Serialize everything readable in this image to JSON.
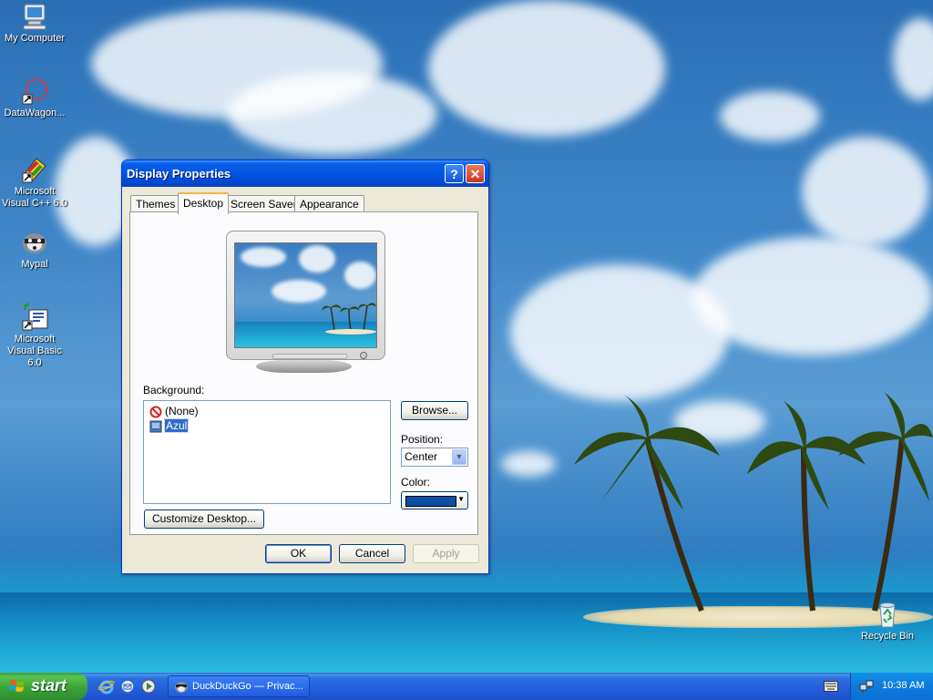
{
  "desktop": {
    "icons": [
      {
        "label": "My Computer",
        "icon": "computer-icon"
      },
      {
        "label": "DataWagon...",
        "icon": "datawagon-icon"
      },
      {
        "label": "Microsoft Visual C++ 6.0",
        "icon": "visual-cpp-icon"
      },
      {
        "label": "Mypal",
        "icon": "mypal-icon"
      },
      {
        "label": "Microsoft Visual Basic 6.0",
        "icon": "visual-basic-icon"
      },
      {
        "label": "Recycle Bin",
        "icon": "recycle-bin-icon"
      }
    ]
  },
  "window": {
    "title": "Display Properties",
    "help_glyph": "?",
    "close_glyph": "✕",
    "tabs": [
      {
        "label": "Themes"
      },
      {
        "label": "Desktop",
        "active": true
      },
      {
        "label": "Screen Saver"
      },
      {
        "label": "Appearance"
      }
    ],
    "background_label": "Background:",
    "backgrounds": [
      {
        "label": "(None)",
        "icon": "none-icon"
      },
      {
        "label": "Azul",
        "icon": "image-file-icon",
        "selected": true
      }
    ],
    "browse_label": "Browse...",
    "position_label": "Position:",
    "position_value": "Center",
    "color_label": "Color:",
    "color_value": "#0b4fa6",
    "customize_label": "Customize Desktop...",
    "ok_label": "OK",
    "cancel_label": "Cancel",
    "apply_label": "Apply"
  },
  "taskbar": {
    "start_label": "start",
    "quick_launch": [
      "internet-explorer-icon",
      "outlook-express-icon",
      "media-player-icon"
    ],
    "tasks": [
      {
        "label": "DuckDuckGo — Privac...",
        "icon": "mypal-icon"
      }
    ],
    "clock": "10:38 AM"
  },
  "colors": {
    "titlebar": "#0054e3",
    "start_green": "#3aa339",
    "taskbar_blue": "#245edb",
    "selection": "#316ac5"
  }
}
